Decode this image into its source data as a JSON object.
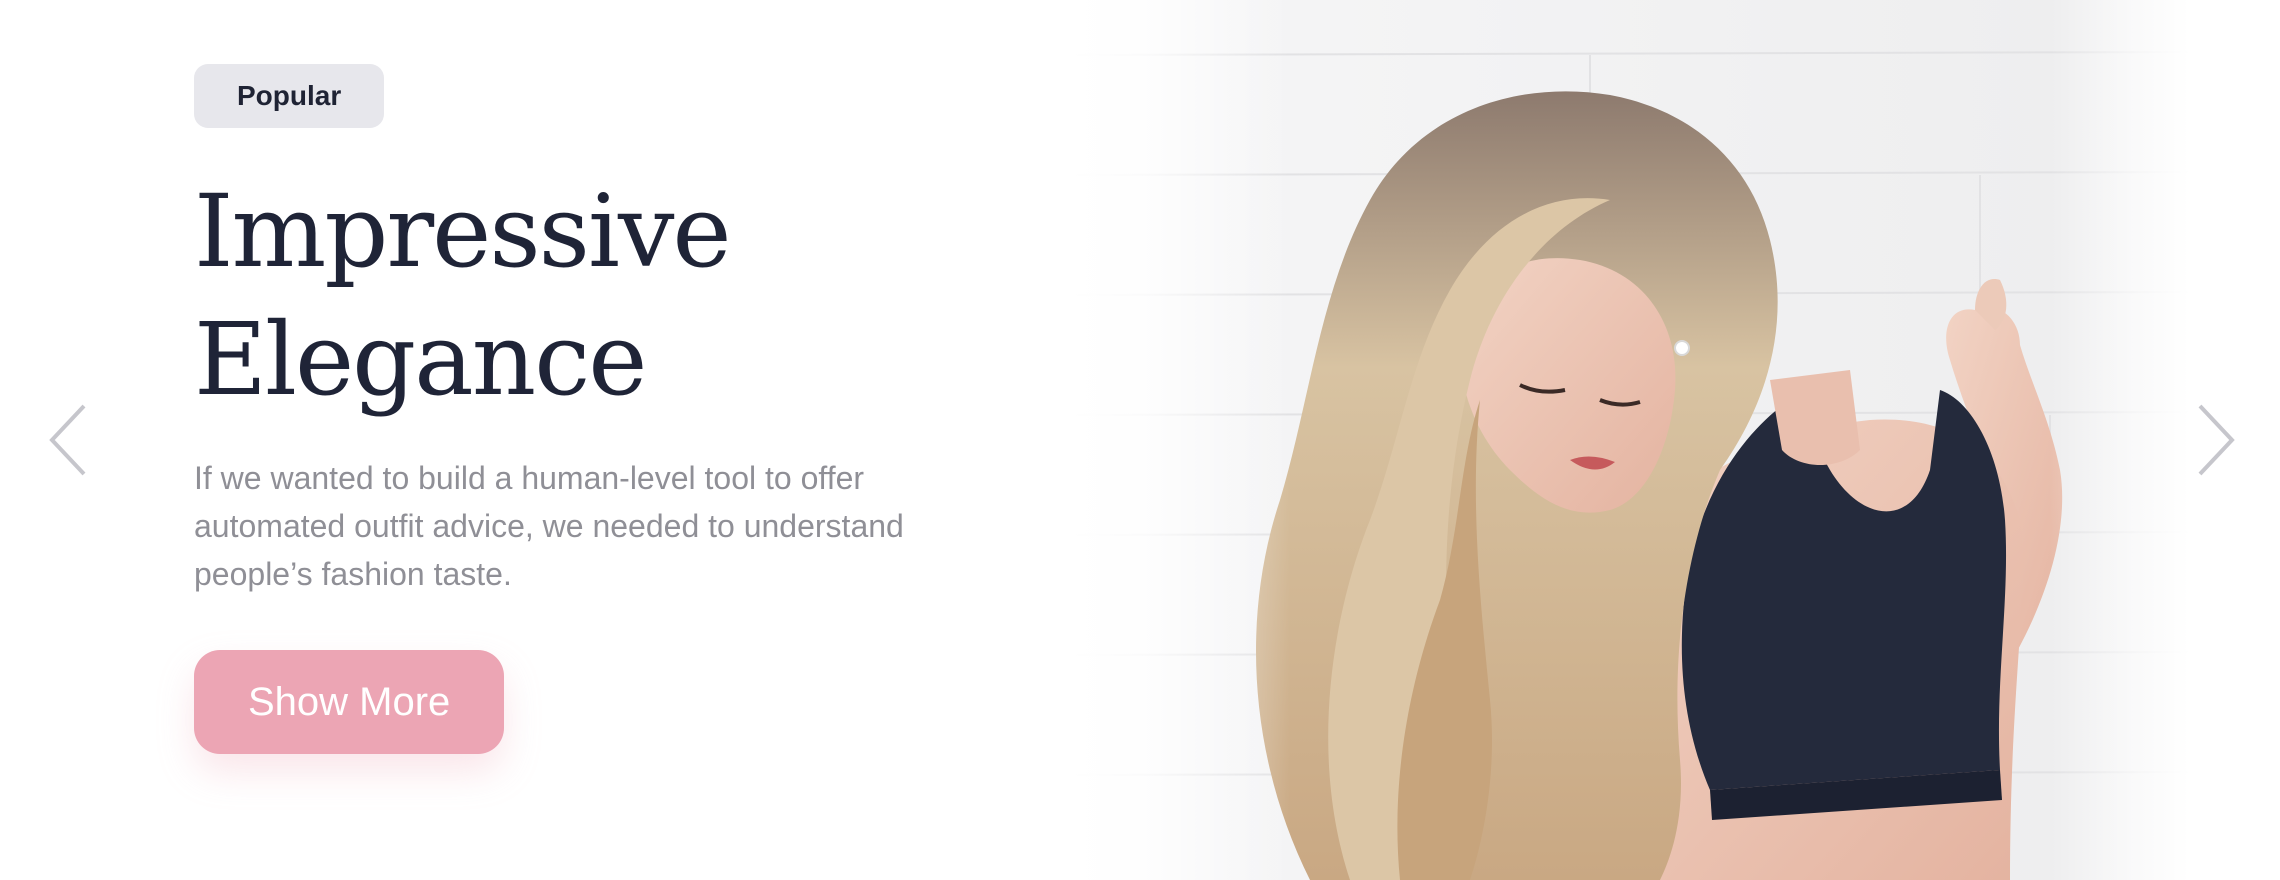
{
  "hero": {
    "badge": "Popular",
    "title_line1": "Impressive",
    "title_line2": "Elegance",
    "description": "If we wanted to build a human-level tool to offer automated outfit advice, we needed to understand people’s fashion taste.",
    "cta_label": "Show More"
  },
  "icons": {
    "prev": "chevron-left-icon",
    "next": "chevron-right-icon"
  },
  "colors": {
    "title": "#1f2437",
    "description": "#8f8f96",
    "badge_bg": "#e7e7ec",
    "cta_bg": "#eca5b4",
    "arrow": "#c6c6cc"
  }
}
